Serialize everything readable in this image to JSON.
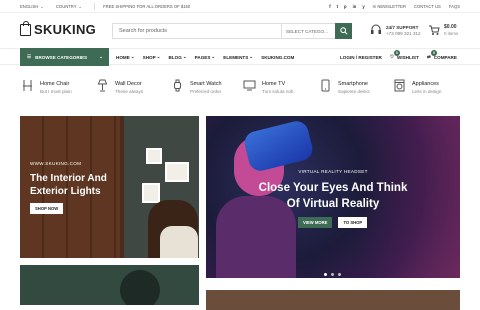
{
  "topbar": {
    "language": "ENGLISH",
    "country": "COUNTRY",
    "shipping": "FREE SHIPPING FOR ALL ORDERS OF $150",
    "newsletter": "NEWSLETTER",
    "contact": "CONTACT US",
    "faqs": "FAQS",
    "social": [
      "f",
      "t",
      "p",
      "in",
      "y"
    ]
  },
  "header": {
    "logo": "SKUKING",
    "search_placeholder": "Search for products",
    "search_category": "SELECT CATEGO...",
    "support_title": "24/7 SUPPORT",
    "support_phone": "+73 099 321 312",
    "cart_total": "$0.00",
    "cart_items": "0 items"
  },
  "nav": {
    "browse": "BROWSE CATEGORIES",
    "menu": [
      "HOME",
      "SHOP",
      "BLOG",
      "PAGES",
      "ELEMENTS",
      "SKUKING.COM"
    ],
    "login": "LOGIN / REGISTER",
    "wishlist": "WISHLIST",
    "compare": "COMPARE",
    "wishlist_count": "0",
    "compare_count": "0"
  },
  "categories": [
    {
      "name": "Home Chair",
      "sub": "But I must plain",
      "icon": "chair-icon"
    },
    {
      "name": "Wall Decor",
      "sub": "These always",
      "icon": "lamp-icon"
    },
    {
      "name": "Smart Watch",
      "sub": "Preferred order",
      "icon": "watch-icon"
    },
    {
      "name": "Home TV",
      "sub": "Tum soluta nob",
      "icon": "tv-icon"
    },
    {
      "name": "Smartphone",
      "sub": "Sapiente delect",
      "icon": "phone-icon"
    },
    {
      "name": "Appliances",
      "sub": "Less in design",
      "icon": "washer-icon"
    }
  ],
  "banner_left": {
    "site": "WWW.SKUKING.COM",
    "title": "The Interior And Exterior Lights",
    "button": "SHOP NOW"
  },
  "banner_main": {
    "kicker": "VIRTUAL REALITY HEADSET",
    "title_line1": "Close Your Eyes And Think",
    "title_line2": "Of Virtual Reality",
    "btn_primary": "VIEW MORE",
    "btn_secondary": "TO SHOP"
  },
  "colors": {
    "accent": "#3e6b54"
  }
}
